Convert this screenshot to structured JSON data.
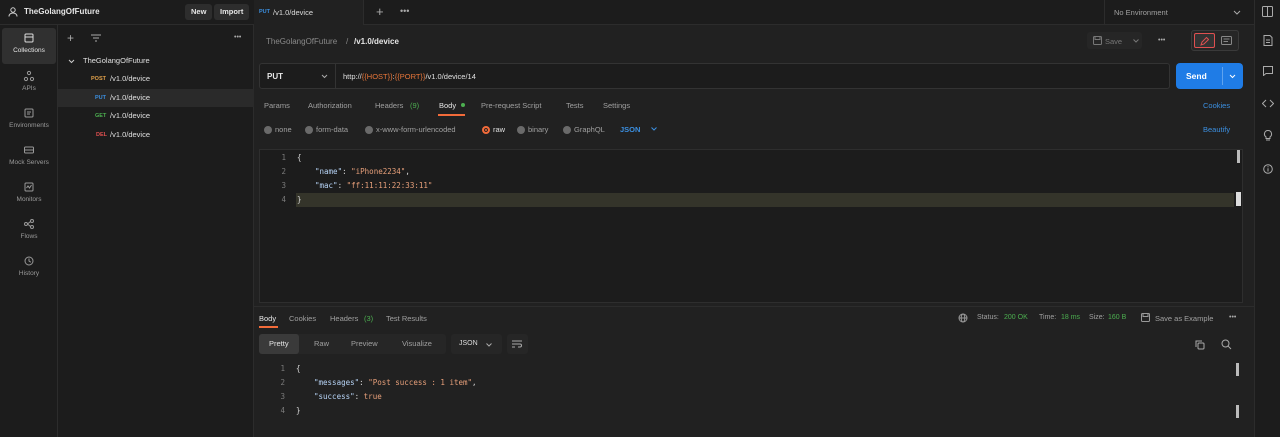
{
  "workspace": {
    "name": "TheGolangOfFuture",
    "new_label": "New",
    "import_label": "Import"
  },
  "open_tab": {
    "method": "PUT",
    "title": "/v1.0/device"
  },
  "environment": {
    "selected": "No Environment"
  },
  "rail": [
    {
      "label": "Collections",
      "icon": "collections-icon"
    },
    {
      "label": "APIs",
      "icon": "apis-icon"
    },
    {
      "label": "Environments",
      "icon": "environments-icon"
    },
    {
      "label": "Mock Servers",
      "icon": "mock-servers-icon"
    },
    {
      "label": "Monitors",
      "icon": "monitors-icon"
    },
    {
      "label": "Flows",
      "icon": "flows-icon"
    },
    {
      "label": "History",
      "icon": "history-icon"
    }
  ],
  "sidebar": {
    "collection": "TheGolangOfFuture",
    "items": [
      {
        "method": "POST",
        "path": "/v1.0/device",
        "color": "#e0a04a"
      },
      {
        "method": "PUT",
        "path": "/v1.0/device",
        "color": "#3b8fe0"
      },
      {
        "method": "GET",
        "path": "/v1.0/device",
        "color": "#4caf50"
      },
      {
        "method": "DEL",
        "path": "/v1.0/device",
        "color": "#e05050"
      }
    ]
  },
  "breadcrumb": {
    "parent": "TheGolangOfFuture",
    "separator": "/",
    "current": "/v1.0/device"
  },
  "save_label": "Save",
  "request": {
    "method": "PUT",
    "url_prefix": "http://",
    "url_var1": "{{HOST}}",
    "url_colon": ":",
    "url_var2": "{{PORT}}",
    "url_suffix": "/v1.0/device/14",
    "send_label": "Send"
  },
  "request_tabs": {
    "params": "Params",
    "authorization": "Authorization",
    "headers": "Headers",
    "headers_count": "(9)",
    "body": "Body",
    "prerequest": "Pre-request Script",
    "tests": "Tests",
    "settings": "Settings",
    "cookies": "Cookies"
  },
  "body_types": {
    "none": "none",
    "form_data": "form-data",
    "urlencoded": "x-www-form-urlencoded",
    "raw": "raw",
    "binary": "binary",
    "graphql": "GraphQL",
    "language": "JSON",
    "beautify": "Beautify"
  },
  "request_body": {
    "line_numbers": [
      "1",
      "2",
      "3",
      "4"
    ],
    "open": "{",
    "name_key": "\"name\"",
    "name_val": "\"iPhone2234\"",
    "mac_key": "\"mac\"",
    "mac_val": "\"ff:11:11:22:33:11\"",
    "close": "}"
  },
  "response_tabs": {
    "body": "Body",
    "cookies": "Cookies",
    "headers": "Headers",
    "headers_count": "(3)",
    "test_results": "Test Results"
  },
  "response_meta": {
    "status_label": "Status:",
    "status": "200 OK",
    "time_label": "Time:",
    "time": "18 ms",
    "size_label": "Size:",
    "size": "160 B",
    "save_example": "Save as Example"
  },
  "view_modes": {
    "pretty": "Pretty",
    "raw": "Raw",
    "preview": "Preview",
    "visualize": "Visualize",
    "format": "JSON"
  },
  "response_body": {
    "line_numbers": [
      "1",
      "2",
      "3",
      "4"
    ],
    "open": "{",
    "messages_key": "\"messages\"",
    "messages_val": "\"Post success : 1 item\"",
    "success_key": "\"success\"",
    "success_val": "true",
    "close": "}"
  },
  "colors": {
    "accent": "#1f7ce6",
    "tab_underline": "#f26b3a",
    "status_ok": "#4caf50"
  }
}
